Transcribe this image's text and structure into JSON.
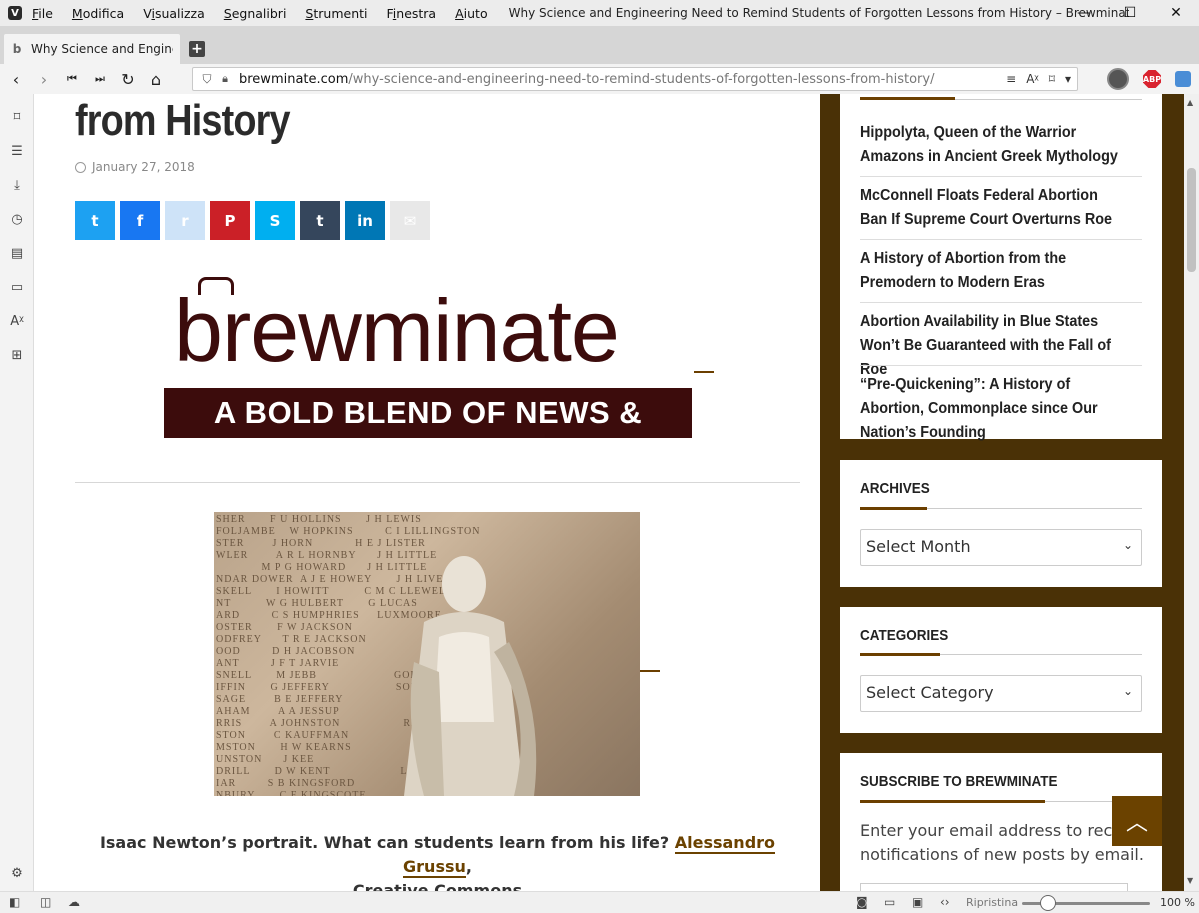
{
  "window": {
    "menu": [
      {
        "pre": "",
        "ul": "F",
        "post": "ile"
      },
      {
        "pre": "",
        "ul": "M",
        "post": "odifica"
      },
      {
        "pre": "V",
        "ul": "i",
        "post": "sualizza"
      },
      {
        "pre": "",
        "ul": "S",
        "post": "egnalibri"
      },
      {
        "pre": "",
        "ul": "S",
        "post": "trumenti"
      },
      {
        "pre": "F",
        "ul": "i",
        "post": "nestra"
      },
      {
        "pre": "",
        "ul": "A",
        "post": "iuto"
      }
    ],
    "title": "Why Science and Engineering Need to Remind Students of Forgotten Lessons from History – Brewminate: A B...",
    "controls": {
      "minimize": "—",
      "maximize": "☐",
      "close": "✕"
    }
  },
  "tabs": [
    {
      "label": "Why Science and Engineering"
    }
  ],
  "address": {
    "host": "brewminate.com",
    "path": "/why-science-and-engineering-need-to-remind-students-of-forgotten-lessons-from-history/"
  },
  "article": {
    "title_fragment": "from History",
    "date": "January 27, 2018",
    "share_buttons": [
      {
        "name": "twitter",
        "glyph": "t",
        "color": "#1da1f2"
      },
      {
        "name": "facebook",
        "glyph": "f",
        "color": "#1877f2"
      },
      {
        "name": "reddit",
        "glyph": "r",
        "color": "#cee3f8"
      },
      {
        "name": "pinterest",
        "glyph": "P",
        "color": "#cb2027"
      },
      {
        "name": "skype",
        "glyph": "S",
        "color": "#00aff0"
      },
      {
        "name": "tumblr",
        "glyph": "t",
        "color": "#35465c"
      },
      {
        "name": "linkedin",
        "glyph": "in",
        "color": "#0077b5"
      },
      {
        "name": "email",
        "glyph": "✉",
        "color": "#e8e8e8"
      }
    ],
    "logo": {
      "wordmark": "brewminate",
      "tagline": "A BOLD BLEND OF NEWS & IDEAS"
    },
    "caption": {
      "text": "Isaac Newton’s portrait. What can students learn from his life?",
      "author": "Alessandro Grussu",
      "license_prefix": ",",
      "license": "Creative Commons"
    }
  },
  "sidebar": {
    "recent_posts": [
      "Hippolyta, Queen of the Warrior Amazons in Ancient Greek Mythology",
      "McConnell Floats Federal Abortion Ban If Supreme Court Overturns Roe",
      "A History of Abortion from the Premodern to Modern Eras",
      "Abortion Availability in Blue States Won’t Be Guaranteed with the Fall of Roe",
      "“Pre-Quickening”: A History of Abortion, Commonplace since Our Nation’s Founding"
    ],
    "archives": {
      "title": "ARCHIVES",
      "select": "Select Month"
    },
    "categories": {
      "title": "CATEGORIES",
      "select": "Select Category"
    },
    "subscribe": {
      "title": "SUBSCRIBE TO BREWMINATE",
      "text": "Enter your email address to receive notifications of new posts by email."
    }
  },
  "statusbar": {
    "reset_label": "Ripristina",
    "zoom": "100 %"
  },
  "colors": {
    "accent": "#6b4200",
    "page_bg": "#4a3106",
    "logo": "#3c0c0c"
  }
}
